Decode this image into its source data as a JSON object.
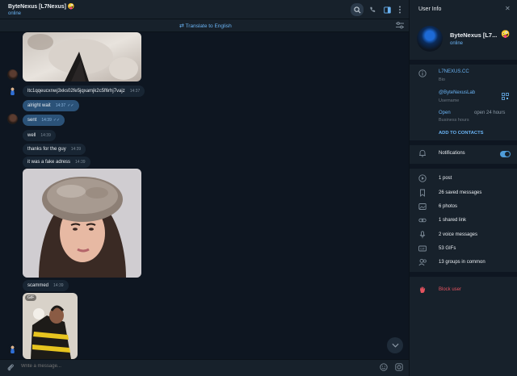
{
  "chat": {
    "title": "ByteNexus [L7Nexus]",
    "title_emoji": "🤪",
    "status": "online",
    "translate": "Translate to English"
  },
  "messages": [
    {
      "text": "ltc1qqeucxnwj3xks02fe5jqxamjk2c5f6rhj7vajz",
      "time": "14:37",
      "dir": "in"
    },
    {
      "text": "alright wait",
      "time": "14:37",
      "dir": "out"
    },
    {
      "text": "sent",
      "time": "14:39",
      "dir": "out"
    },
    {
      "text": "well",
      "time": "14:39",
      "dir": "in"
    },
    {
      "text": "thanks for the guy",
      "time": "14:39",
      "dir": "in"
    },
    {
      "text": "it was a fake adress",
      "time": "14:39",
      "dir": "in"
    },
    {
      "text": "scammed",
      "time": "14:39",
      "dir": "in"
    }
  ],
  "gif_badge": "GIF",
  "composer": {
    "placeholder": "Write a message..."
  },
  "info": {
    "title": "User Info",
    "name": "ByteNexus [L7...",
    "name_emoji": "🤪",
    "status": "online",
    "bio_value": "L7NEXUS.CC",
    "bio_label": "Bio",
    "username_value": "@ByteNexusLab",
    "username_label": "Username",
    "hours_value": "Open",
    "hours_extra": "open 24 hours",
    "hours_label": "Business hours",
    "add_contacts": "ADD TO CONTACTS",
    "notifications": "Notifications",
    "media": [
      {
        "icon": "post-icon",
        "label": "1 post"
      },
      {
        "icon": "bookmark-icon",
        "label": "26 saved messages"
      },
      {
        "icon": "photo-icon",
        "label": "6 photos"
      },
      {
        "icon": "link-icon",
        "label": "1 shared link"
      },
      {
        "icon": "mic-icon",
        "label": "2 voice messages"
      },
      {
        "icon": "gif-icon",
        "label": "53 GIFs"
      },
      {
        "icon": "group-icon",
        "label": "13 groups in common"
      }
    ],
    "block": "Block user"
  },
  "colors": {
    "accent": "#6ab3f3",
    "danger": "#e5535f",
    "bg": "#0e1621",
    "panel": "#17212b",
    "outgoing": "#2b5278"
  }
}
